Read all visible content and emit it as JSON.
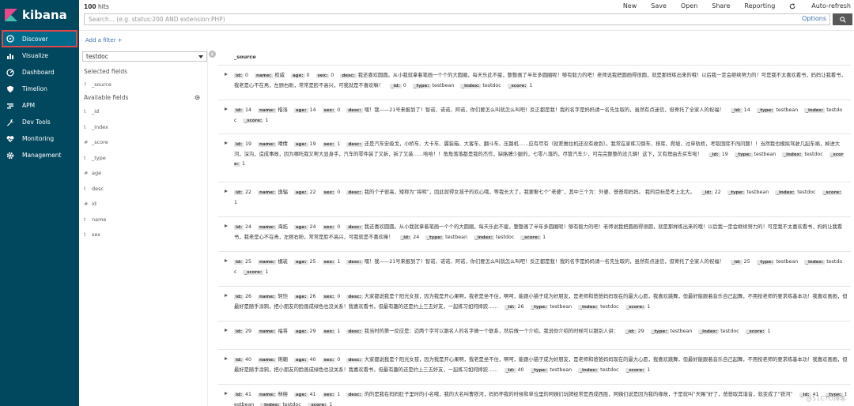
{
  "app": {
    "name": "kibana"
  },
  "sidebar": {
    "items": [
      {
        "label": "Discover",
        "icon": "compass-icon"
      },
      {
        "label": "Visualize",
        "icon": "bar-chart-icon"
      },
      {
        "label": "Dashboard",
        "icon": "dashboard-icon"
      },
      {
        "label": "Timelion",
        "icon": "shield-icon"
      },
      {
        "label": "APM",
        "icon": "apm-icon"
      },
      {
        "label": "Dev Tools",
        "icon": "wrench-icon"
      },
      {
        "label": "Monitoring",
        "icon": "heartbeat-icon"
      },
      {
        "label": "Management",
        "icon": "gear-icon"
      }
    ]
  },
  "topbar": {
    "hits_count": "100",
    "hits_label": "hits",
    "menu": [
      "New",
      "Save",
      "Open",
      "Share",
      "Reporting"
    ],
    "auto_refresh": "Auto-refresh",
    "search_placeholder": "Search... (e.g. status:200 AND extension:PHP)",
    "options": "Options"
  },
  "filter": {
    "add_filter": "Add a filter +"
  },
  "field_panel": {
    "index": "testdoc",
    "selected_heading": "Selected fields",
    "selected_fields": [
      {
        "type": "?",
        "name": "_source"
      }
    ],
    "available_heading": "Available fields",
    "available_fields": [
      {
        "type": "t",
        "name": "_id"
      },
      {
        "type": "t",
        "name": "_index"
      },
      {
        "type": "#",
        "name": "_score"
      },
      {
        "type": "t",
        "name": "_type"
      },
      {
        "type": "#",
        "name": "age"
      },
      {
        "type": "t",
        "name": "desc"
      },
      {
        "type": "#",
        "name": "id"
      },
      {
        "type": "t",
        "name": "name"
      },
      {
        "type": "t",
        "name": "sex"
      }
    ]
  },
  "documents": {
    "header": "_source",
    "rows": [
      {
        "id": "0",
        "name": "权威",
        "age": "0",
        "sex": "0",
        "desc": "我还喜欢圆圆。从小我就拿着笔画一个个的大圆圈，每天乐此不疲，整整画了半年多圆圈呢！够有毅力的吧！老师说我把圆画得很圆，就是那样练出来的哦！以后我一定会继续努力的！可是我不太喜欢看书，妈妈让我看书，我老是心不在焉，左顾右盼，常常是脸不高兴，可我就是不喜欢嘛！",
        "_id": "0",
        "_type": "testbean",
        "_index": "testdoc",
        "_score": "1"
      },
      {
        "id": "14",
        "name": "楷洛",
        "age": "14",
        "sex": "0",
        "desc": "嘿！我——21号来报到了！智诺、诺诺、阿诺，你们要怎么叫就怎么叫吧！反正都是我！我的名字是妈妈请一名先生取的，虽然有点迷信，但寄托了全家人的祝福！",
        "_id": "14",
        "_type": "testbean",
        "_index": "testdoc",
        "_score": "1"
      },
      {
        "id": "19",
        "name": "晴倩",
        "age": "19",
        "sex": "1",
        "desc": "还是汽车安级戈，小桥车、大卡车、翼装箱、大客车、翻斗车、压路机……应有尽有（就差推拉机还没有收到）。我常在家练习倒车、移库、爬坡、过单轨桥，考取国际不闯问题！！当然我也模拟驾驶几起车祸，掉进大河，深沟，造成事故，因为哪吒我又帮大显身手，汽车的零件装了又拆，拆了又装……哈哈！！角角落落都是我的杰作，缺胳膊少腿的，七零八落的，尽管汽车少，可完完整整的没几辆！这下，又有理由去买车啦！",
        "_id": "19",
        "_type": "testbean",
        "_index": "testdoc",
        "_score": "1"
      },
      {
        "id": "22",
        "name": "逸辐",
        "age": "22",
        "sex": "0",
        "desc": "我的个子很高，矮称为“将明”，因此就得女孩子的欢心哦，等我长大了，我要娶七个“老婆”，其中三个为：外婆、爸爸和妈妈。 我的目标是考上北大。",
        "_id": "22",
        "_type": "testbean",
        "_index": "testdoc",
        "_score": "1"
      },
      {
        "id": "24",
        "name": "海拓",
        "age": "24",
        "sex": "0",
        "desc": "我还喜欢圆圆。从小我就拿着笔画一个个的大圆圈，每天乐此不疲，整整画了半年多圆圈呢！够有毅力的吧！老师说我把圆画得很圆，就是那样练出来的哦！以后我一定会继续努力的！可是我不太喜欢看书，妈妈让我看书，我老是心不在焉，左顾右盼，常常是脸不高兴，可我就是不喜欢嘛！",
        "_id": "24",
        "_type": "testbean",
        "_index": "testdoc",
        "_score": "1"
      },
      {
        "id": "25",
        "name": "楣裟",
        "age": "25",
        "sex": "1",
        "desc": "嘿！我——21号来报到了！智诺、诺诺、阿诺，你们要怎么叫就怎么叫吧！反正都是我！我的名字是妈妈请一名先生取的，虽然有点迷信，但寄托了全家人的祝福！",
        "_id": "25",
        "_type": "testbean",
        "_index": "testdoc",
        "_score": "1"
      },
      {
        "id": "26",
        "name": "轲恺",
        "age": "26",
        "sex": "0",
        "desc": "大家都说我是个阳光女孩，因为我是开心果啊，我老是坐不住，啊呵，能跟小猫子成为好朋友，是老师和爸爸妈妈现在的最大心愿，我喜欢跳舞，但最好能跟着音乐自己起舞，不用按老师的要求练基本功！我喜欢画画，但最好是随手涂鸦，把小朋友的脸画成绿色也没关系！我喜欢看书，但最有趣的还是约上三五好友，一起练习如何摔跤……",
        "_id": "26",
        "_type": "testbean",
        "_index": "testdoc",
        "_score": "1"
      },
      {
        "id": "29",
        "name": "福将",
        "age": "29",
        "sex": "1",
        "desc": "我当时的第一反应是：迈两个字可以跟名人的名字做一个联系，然后做一个介绍，我说你介绍的时候可以跟别人讲：",
        "_id": "29",
        "_type": "testbean",
        "_index": "testdoc",
        "_score": "1"
      },
      {
        "id": "40",
        "name": "俐翱",
        "age": "40",
        "sex": "0",
        "desc": "大家都说我是个阳光女孩，因为我是开心果啊，我老是坐不住，啊呵，能跟小猫子成为好朋友，是老师和爸爸妈妈现在的最大心愿，我喜欢跳舞，但最好能跟着音乐自己起舞，不用按老师的要求练基本功！我喜欢画画，但最好是随手涂鸦，把小朋友的脸画成绿色也没关系！我喜欢看书，但最有趣的还是约上三五好友，一起练习如何摔跤……",
        "_id": "40",
        "_type": "testbean",
        "_index": "testdoc",
        "_score": "1"
      },
      {
        "id": "41",
        "name": "林榕",
        "age": "41",
        "sex": "1",
        "desc": "的的是我在妈妈肚子里时的小名哦，我的大名叫曹铁河，妈妈怀我的时候和单位里的阿姨们玩牌经常是西成西胜，阿姨们说是因为我的缘故，于是就叫“天赐”好了，爸爸取其谐音，就变成了“铁河”",
        "_id": "41",
        "_type": "testbean",
        "_index": "testdoc",
        "_score": "1"
      }
    ]
  },
  "watermark": "@51CTO博客"
}
